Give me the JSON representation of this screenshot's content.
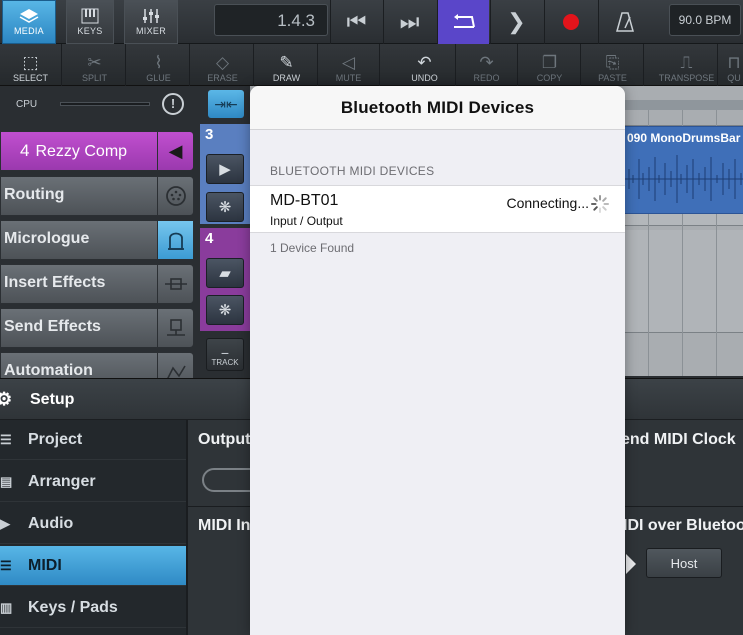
{
  "transport": {
    "media_label": "MEDIA",
    "keys_label": "KEYS",
    "mixer_label": "MIXER",
    "position": "1.4.3",
    "tempo": "90.0 BPM",
    "loop_color": "#5a46c9",
    "record_color": "#e3141b"
  },
  "tools": [
    {
      "label": "SELECT",
      "icon": "select-icon",
      "enabled": true
    },
    {
      "label": "SPLIT",
      "icon": "scissors-icon",
      "enabled": false
    },
    {
      "label": "GLUE",
      "icon": "glue-icon",
      "enabled": false
    },
    {
      "label": "ERASE",
      "icon": "eraser-icon",
      "enabled": false
    },
    {
      "label": "DRAW",
      "icon": "pencil-icon",
      "enabled": true
    },
    {
      "label": "MUTE",
      "icon": "speaker-icon",
      "enabled": false
    },
    {
      "label": "UNDO",
      "icon": "undo-icon",
      "enabled": true
    },
    {
      "label": "REDO",
      "icon": "redo-icon",
      "enabled": false
    },
    {
      "label": "COPY",
      "icon": "copy-icon",
      "enabled": false
    },
    {
      "label": "PASTE",
      "icon": "paste-icon",
      "enabled": false
    },
    {
      "label": "TRANSPOSE",
      "icon": "transpose-icon",
      "enabled": false
    },
    {
      "label": "QU",
      "icon": "quantize-icon",
      "enabled": false
    }
  ],
  "inspector": {
    "cpu_label": "CPU",
    "track_number": "4",
    "track_name": "Rezzy Comp",
    "sections": [
      "Routing",
      "Micrologue",
      "Insert Effects",
      "Send Effects",
      "Automation"
    ]
  },
  "tracks": {
    "track3_number": "3",
    "track4_number": "4",
    "track_button_label": "TRACK",
    "clip_name": "090 MonoDrumsBar"
  },
  "settings": {
    "title": "Setup",
    "nav": [
      "Project",
      "Arranger",
      "Audio",
      "MIDI",
      "Keys / Pads"
    ],
    "active_nav": "MIDI",
    "output_label": "Output",
    "send_midi_clock_label": "end MIDI Clock",
    "midi_input_label": "MIDI In",
    "midi_bluetooth_label": "IDI over Bluetoo",
    "host_label": "Host"
  },
  "popover": {
    "title": "Bluetooth MIDI Devices",
    "section_header": "BLUETOOTH MIDI DEVICES",
    "device_name": "MD-BT01",
    "device_type": "Input / Output",
    "device_status": "Connecting...",
    "found_count": "1 Device Found"
  }
}
